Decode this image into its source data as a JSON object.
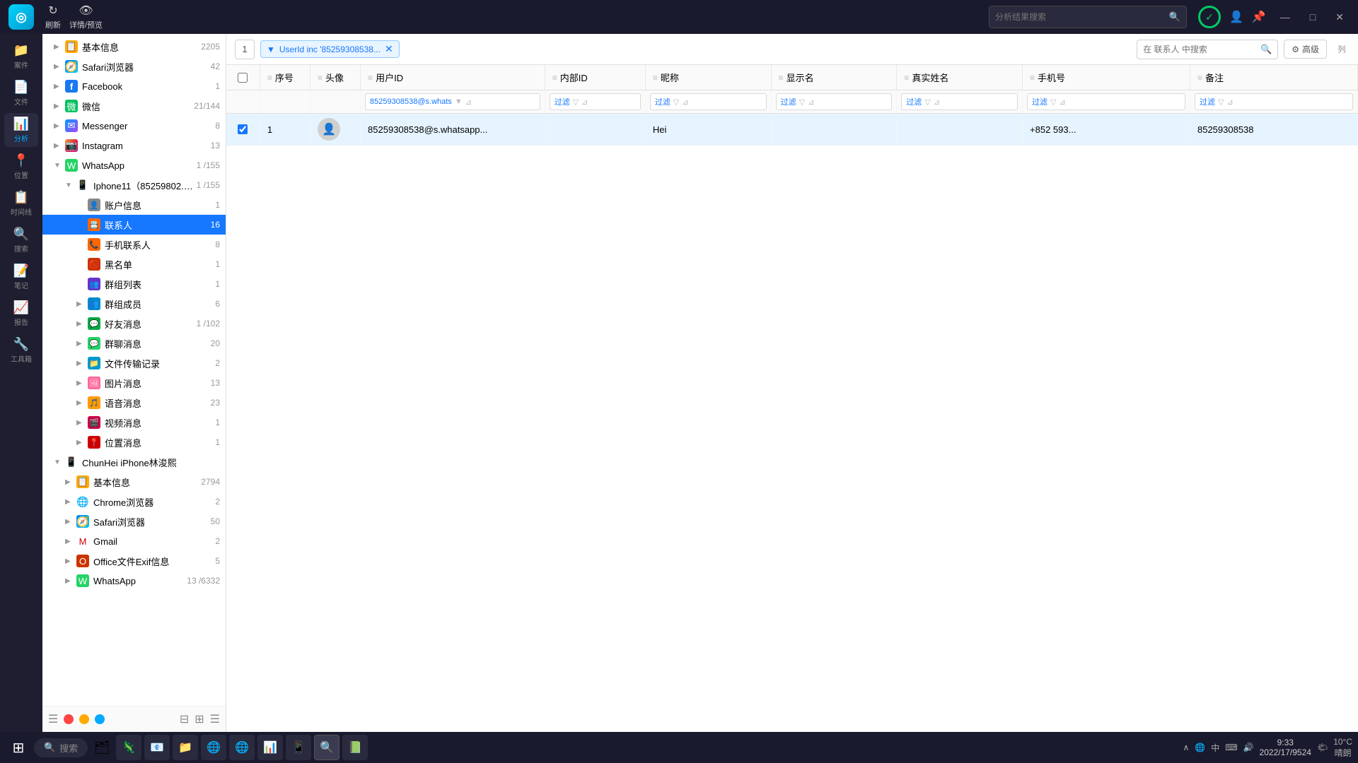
{
  "titlebar": {
    "logo": "◎",
    "refresh_label": "刷新",
    "refresh_icon": "↻",
    "detail_label": "详情/预览",
    "detail_icon": "👁",
    "search_placeholder": "分析结果搜索",
    "user_icon": "👤",
    "pin_icon": "📌",
    "minimize_icon": "—",
    "maximize_icon": "□",
    "close_icon": "✕",
    "green_circle": "●"
  },
  "sidebar_icons": [
    {
      "id": "cases",
      "icon": "📁",
      "label": "案件"
    },
    {
      "id": "documents",
      "icon": "📄",
      "label": "文件"
    },
    {
      "id": "analysis",
      "icon": "📊",
      "label": "分析",
      "active": true
    },
    {
      "id": "location",
      "icon": "📍",
      "label": "位置"
    },
    {
      "id": "timeline",
      "icon": "📋",
      "label": "时间线"
    },
    {
      "id": "search",
      "icon": "🔍",
      "label": "搜索"
    },
    {
      "id": "notes",
      "icon": "📝",
      "label": "笔记"
    },
    {
      "id": "reports",
      "icon": "📈",
      "label": "报告"
    },
    {
      "id": "tools",
      "icon": "🔧",
      "label": "工具箱"
    }
  ],
  "tree": {
    "items": [
      {
        "id": "basic-info-top",
        "indent": 1,
        "icon": "📋",
        "icon_type": "folder",
        "label": "基本信息",
        "count": "2205",
        "expand": "▶"
      },
      {
        "id": "safari-top",
        "indent": 1,
        "icon": "🧭",
        "icon_type": "safari",
        "label": "Safari浏览器",
        "count": "42",
        "expand": "▶"
      },
      {
        "id": "facebook",
        "indent": 1,
        "icon": "f",
        "icon_type": "facebook",
        "label": "Facebook",
        "count": "1",
        "expand": "▶"
      },
      {
        "id": "wechat",
        "indent": 1,
        "icon": "微",
        "icon_type": "wechat",
        "label": "微信",
        "count": "21/144",
        "expand": "▶"
      },
      {
        "id": "messenger",
        "indent": 1,
        "icon": "✉",
        "icon_type": "messenger",
        "label": "Messenger",
        "count": "8",
        "expand": "▶"
      },
      {
        "id": "instagram",
        "indent": 1,
        "icon": "📷",
        "icon_type": "instagram",
        "label": "Instagram",
        "count": "13",
        "expand": "▶"
      },
      {
        "id": "whatsapp",
        "indent": 1,
        "icon": "W",
        "icon_type": "whatsapp",
        "label": "WhatsApp",
        "count": "1 /155",
        "expand": "▼",
        "expanded": true
      },
      {
        "id": "iphone11",
        "indent": 2,
        "icon": "📱",
        "icon_type": "folder",
        "label": "Iphone11（85259802...）",
        "count": "1 /155",
        "expand": "▼",
        "expanded": true
      },
      {
        "id": "account-info",
        "indent": 3,
        "icon": "👤",
        "icon_type": "account",
        "label": "账户信息",
        "count": "1",
        "expand": ""
      },
      {
        "id": "contacts",
        "indent": 3,
        "icon": "📇",
        "icon_type": "contact",
        "label": "联系人",
        "count": "16",
        "expand": "",
        "selected": true
      },
      {
        "id": "phone-contacts",
        "indent": 3,
        "icon": "📞",
        "icon_type": "phone-contact",
        "label": "手机联系人",
        "count": "8",
        "expand": ""
      },
      {
        "id": "blacklist",
        "indent": 3,
        "icon": "🚫",
        "icon_type": "blacklist",
        "label": "黑名单",
        "count": "1",
        "expand": ""
      },
      {
        "id": "group-list",
        "indent": 3,
        "icon": "👥",
        "icon_type": "group-list",
        "label": "群组列表",
        "count": "1",
        "expand": ""
      },
      {
        "id": "group-members",
        "indent": 3,
        "icon": "👥",
        "icon_type": "group-member",
        "label": "群组成员",
        "count": "6",
        "expand": "▶"
      },
      {
        "id": "friend-msg",
        "indent": 3,
        "icon": "💬",
        "icon_type": "friend-msg",
        "label": "好友消息",
        "count": "1 /102",
        "expand": "▶"
      },
      {
        "id": "group-chat",
        "indent": 3,
        "icon": "💬",
        "icon_type": "chat",
        "label": "群聊消息",
        "count": "20",
        "expand": "▶"
      },
      {
        "id": "file-transfer",
        "indent": 3,
        "icon": "📁",
        "icon_type": "file-transfer",
        "label": "文件传输记录",
        "count": "2",
        "expand": "▶"
      },
      {
        "id": "image-msg",
        "indent": 3,
        "icon": "🖼",
        "icon_type": "image-msg",
        "label": "图片消息",
        "count": "13",
        "expand": "▶"
      },
      {
        "id": "audio-msg",
        "indent": 3,
        "icon": "🎵",
        "icon_type": "audio-msg",
        "label": "语音消息",
        "count": "23",
        "expand": "▶"
      },
      {
        "id": "video-msg",
        "indent": 3,
        "icon": "🎬",
        "icon_type": "video-msg",
        "label": "视频消息",
        "count": "1",
        "expand": "▶"
      },
      {
        "id": "location-msg",
        "indent": 3,
        "icon": "📍",
        "icon_type": "location",
        "label": "位置消息",
        "count": "1",
        "expand": "▶"
      },
      {
        "id": "chunhei-iphone",
        "indent": 1,
        "icon": "📱",
        "icon_type": "folder",
        "label": "ChunHei iPhone林浚熙",
        "count": "",
        "expand": "▼",
        "expanded": true
      },
      {
        "id": "basic-info-2",
        "indent": 2,
        "icon": "📋",
        "icon_type": "folder",
        "label": "基本信息",
        "count": "2794",
        "expand": "▶"
      },
      {
        "id": "chrome-2",
        "indent": 2,
        "icon": "🌐",
        "icon_type": "chrome",
        "label": "Chrome浏览器",
        "count": "2",
        "expand": "▶"
      },
      {
        "id": "safari-2",
        "indent": 2,
        "icon": "🧭",
        "icon_type": "safari",
        "label": "Safari浏览器",
        "count": "50",
        "expand": "▶"
      },
      {
        "id": "gmail-2",
        "indent": 2,
        "icon": "M",
        "icon_type": "gmail",
        "label": "Gmail",
        "count": "2",
        "expand": "▶"
      },
      {
        "id": "office-2",
        "indent": 2,
        "icon": "O",
        "icon_type": "office",
        "label": "Office文件Exif信息",
        "count": "5",
        "expand": "▶"
      },
      {
        "id": "whatsapp-2",
        "indent": 2,
        "icon": "W",
        "icon_type": "whatsapp",
        "label": "WhatsApp",
        "count": "13 /6332",
        "expand": "▶"
      }
    ]
  },
  "filter_bar": {
    "page_num": "1",
    "filter_label": "UserId inc '85259308538...",
    "search_placeholder": "在 联系人 中搜索",
    "advanced_label": "高级",
    "advanced_icon": "⚙"
  },
  "table": {
    "columns": [
      {
        "id": "checkbox",
        "label": ""
      },
      {
        "id": "seq",
        "label": "序号"
      },
      {
        "id": "avatar",
        "label": "头像"
      },
      {
        "id": "userid",
        "label": "用户ID"
      },
      {
        "id": "innerid",
        "label": "内部ID"
      },
      {
        "id": "alias",
        "label": "昵称"
      },
      {
        "id": "display",
        "label": "显示名"
      },
      {
        "id": "realname",
        "label": "真实姓名"
      },
      {
        "id": "phone",
        "label": "手机号"
      },
      {
        "id": "remark",
        "label": "备注"
      }
    ],
    "filter_row": {
      "userid_filter": "85259308538@s.whats",
      "innerid_filter": "过滤",
      "alias_filter": "过滤",
      "display_filter": "过滤",
      "realname_filter": "过滤",
      "phone_filter": "过滤",
      "remark_filter": "过滤"
    },
    "rows": [
      {
        "seq": "1",
        "avatar": "👤",
        "userid": "85259308538@s.whatsapp...",
        "innerid": "",
        "alias": "Hei",
        "display": "",
        "realname": "",
        "phone": "+852 593...",
        "remark": "85259308538",
        "selected": true
      }
    ]
  },
  "taskbar": {
    "start_icon": "⊞",
    "search_placeholder": "搜索",
    "time": "9:33",
    "date": "2022/17/9524",
    "weather": "10°C",
    "weather_label": "晴朗",
    "tray_text": "中"
  }
}
